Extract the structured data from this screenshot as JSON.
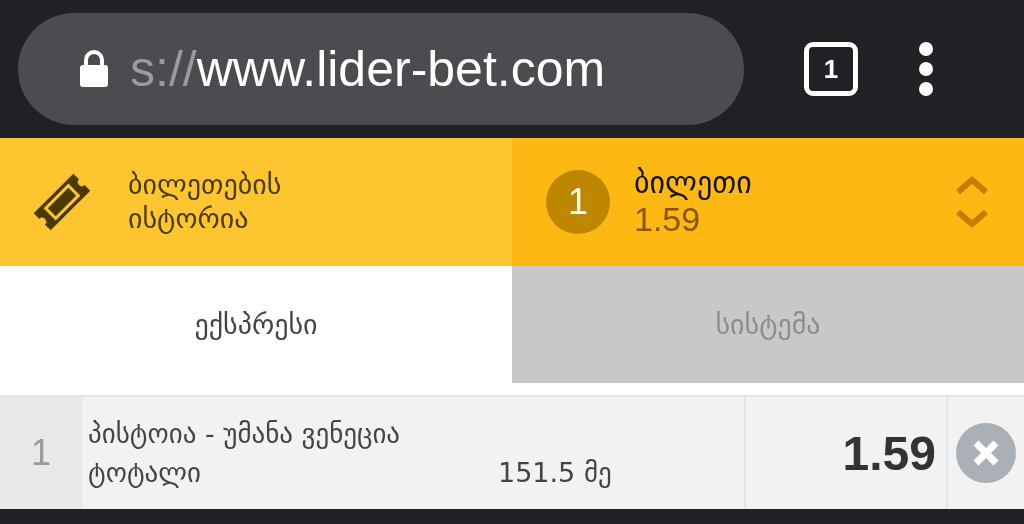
{
  "address_bar": {
    "url_faded": "s://",
    "url": "www.lider-bet.com",
    "tab_count": "1"
  },
  "header": {
    "history_label": "ბილეთების ისტორია",
    "ticket_count": "1",
    "ticket_title": "ბილეთი",
    "ticket_odds": "1.59"
  },
  "tabs": [
    {
      "label": "ექსპრესი",
      "selected": true
    },
    {
      "label": "სისტემა",
      "selected": false
    }
  ],
  "bets": [
    {
      "index": "1",
      "match": "პისტოია - უმანა ვენეცია",
      "market": "ტოტალი",
      "line": "151.5 მე",
      "odds": "1.59"
    }
  ]
}
